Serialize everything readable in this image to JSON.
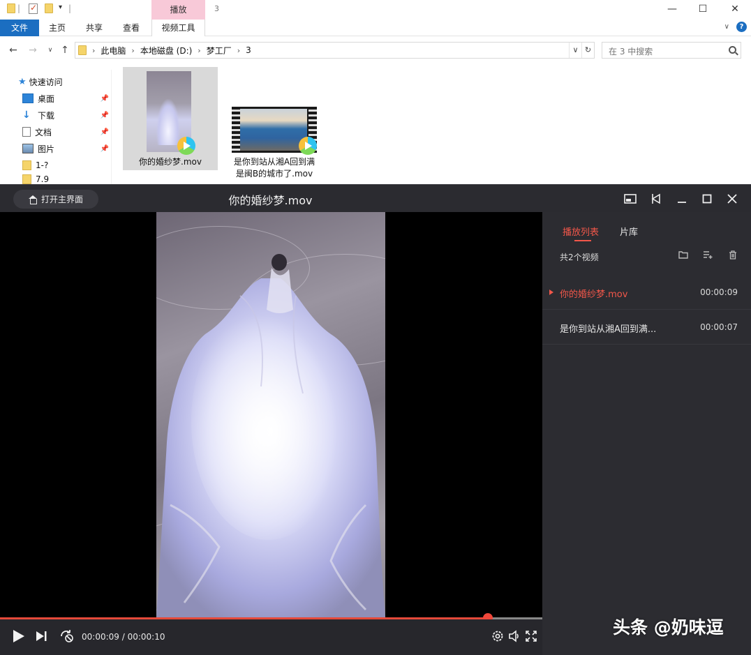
{
  "explorer": {
    "title_path": "3",
    "context_tab": "播放",
    "tabs": [
      "文件",
      "主页",
      "共享",
      "查看",
      "视频工具"
    ],
    "breadcrumb": [
      "此电脑",
      "本地磁盘 (D:)",
      "梦工厂",
      "3"
    ],
    "search_placeholder": "在 3 中搜索",
    "sidebar": {
      "quick_access": "快速访问",
      "items": [
        "桌面",
        "下载",
        "文档",
        "图片",
        "1-?",
        "7.9"
      ]
    },
    "files": [
      {
        "name": "你的婚纱梦.mov",
        "selected": true
      },
      {
        "name_line1": "是你到站从湘A回到满",
        "name_line2": "是闽B的城市了.mov",
        "selected": false
      }
    ]
  },
  "player": {
    "home_button": "打开主界面",
    "title": "你的婚纱梦.mov",
    "progress": 0.9,
    "time_display": "00:00:09 / 00:00:10",
    "playlist": {
      "tabs": [
        "播放列表",
        "片库"
      ],
      "active_tab": "播放列表",
      "count_label": "共2个视频",
      "items": [
        {
          "name": "你的婚纱梦.mov",
          "duration": "00:00:09",
          "active": true
        },
        {
          "name": "是你到站从湘A回到满...",
          "duration": "00:00:07",
          "active": false
        }
      ]
    },
    "accent_color": "#f2574a"
  },
  "watermark": "头条 @奶味逗"
}
